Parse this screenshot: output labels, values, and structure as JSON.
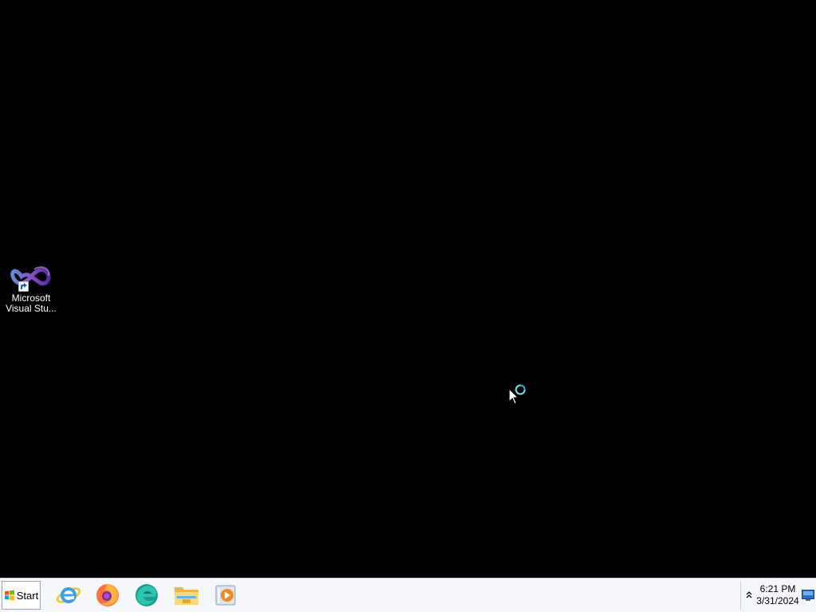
{
  "desktop": {
    "background_color": "#000000",
    "icons": [
      {
        "label_line1": "Microsoft",
        "label_line2": "Visual Stu...",
        "icon": "visual-studio-infinity-icon"
      }
    ]
  },
  "taskbar": {
    "start_label": "Start",
    "pinned_apps": [
      {
        "name": "Internet Explorer",
        "icon": "internet-explorer-icon"
      },
      {
        "name": "Firefox",
        "icon": "firefox-icon"
      },
      {
        "name": "Microsoft Edge",
        "icon": "edge-icon"
      },
      {
        "name": "File Explorer",
        "icon": "file-explorer-icon"
      },
      {
        "name": "Media Player",
        "icon": "media-player-icon"
      }
    ],
    "tray": {
      "chevron": "^",
      "time": "6:21 PM",
      "date": "3/31/2024"
    }
  },
  "cursor": {
    "state": "busy"
  }
}
